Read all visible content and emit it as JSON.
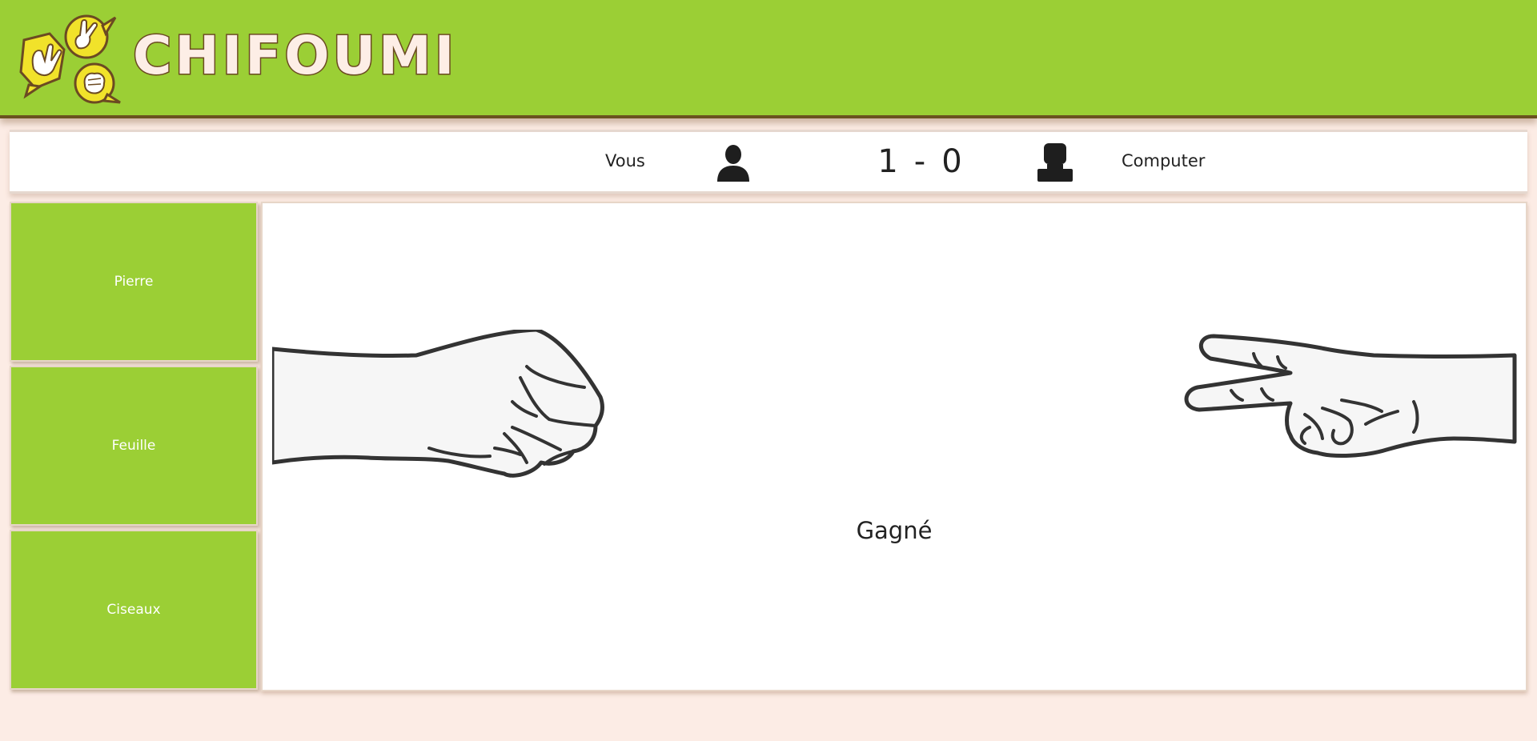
{
  "app": {
    "title": "CHIFOUMI",
    "colors": {
      "primary": "#9bcf35",
      "background": "#fcece5",
      "logo_yellow": "#f1e22a",
      "text_dark": "#222222"
    }
  },
  "scoreboard": {
    "player_label": "Vous",
    "player_score": "1",
    "separator": "-",
    "computer_score": "0",
    "computer_label": "Computer",
    "player_icon": "user-silhouette-icon",
    "computer_icon": "robot-silhouette-icon"
  },
  "choices": [
    {
      "label": "Pierre",
      "icon": "rock-fist"
    },
    {
      "label": "Feuille",
      "icon": "paper-hand"
    },
    {
      "label": "Ciseaux",
      "icon": "scissors-hand"
    }
  ],
  "arena": {
    "player_hand": "rock-fist-hand",
    "computer_hand": "scissors-hand",
    "result_text": "Gagné"
  }
}
